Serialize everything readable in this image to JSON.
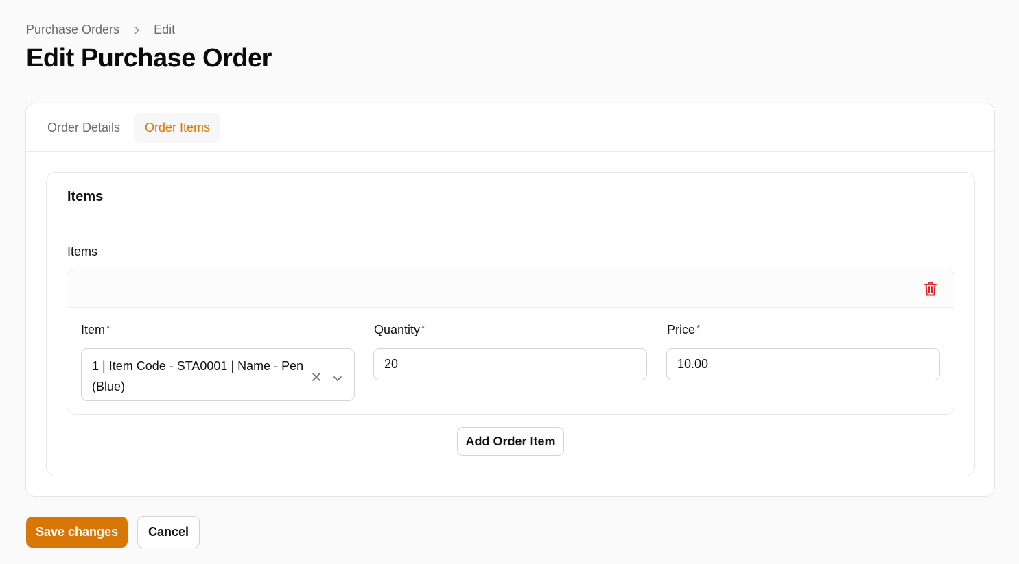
{
  "breadcrumb": {
    "items": [
      "Purchase Orders",
      "Edit"
    ]
  },
  "page": {
    "title": "Edit Purchase Order"
  },
  "tabs": [
    {
      "label": "Order Details",
      "active": false
    },
    {
      "label": "Order Items",
      "active": true
    }
  ],
  "section": {
    "title": "Items",
    "field_label": "Items",
    "item": {
      "item_label": "Item",
      "item_value": "1 | Item Code - STA0001 | Name - Pen (Blue)",
      "quantity_label": "Quantity",
      "quantity_value": "20",
      "price_label": "Price",
      "price_value": "10.00",
      "required_mark": "*"
    },
    "add_button": "Add Order Item"
  },
  "actions": {
    "save": "Save changes",
    "cancel": "Cancel"
  },
  "colors": {
    "accent": "#d97706",
    "danger": "#dc2626"
  },
  "icons": {
    "breadcrumb_separator": "chevron-right-icon",
    "delete": "trash-icon",
    "clear": "close-icon",
    "dropdown": "chevron-down-icon"
  }
}
